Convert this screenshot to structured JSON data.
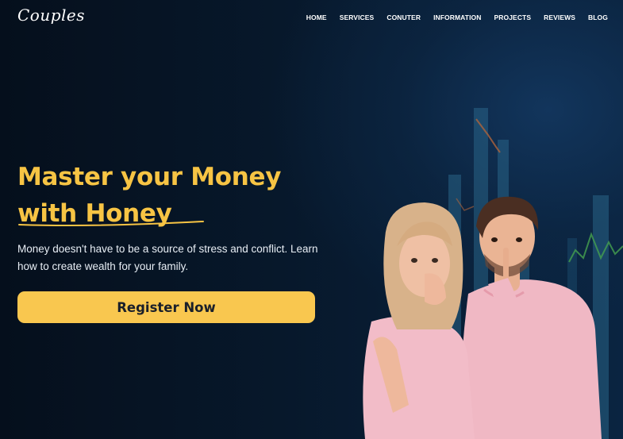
{
  "brand": {
    "logo_text": "Couples"
  },
  "nav": {
    "items": [
      {
        "label": "HOME"
      },
      {
        "label": "SERVICES"
      },
      {
        "label": "CONUTER"
      },
      {
        "label": "INFORMATION"
      },
      {
        "label": "PROJECTS"
      },
      {
        "label": "REVIEWS"
      },
      {
        "label": "BLOG"
      }
    ]
  },
  "hero": {
    "title_line1": "Master your Money",
    "title_line2": "with Honey",
    "description": "Money doesn't have to be a source of stress and conflict. Learn how to create wealth for your family.",
    "cta_label": "Register Now"
  },
  "colors": {
    "accent": "#f9c74f",
    "title": "#f7c444",
    "background": "#061525"
  },
  "images": {
    "hero_photo": "couple-shush-photo",
    "background": "stock-chart-bars"
  }
}
